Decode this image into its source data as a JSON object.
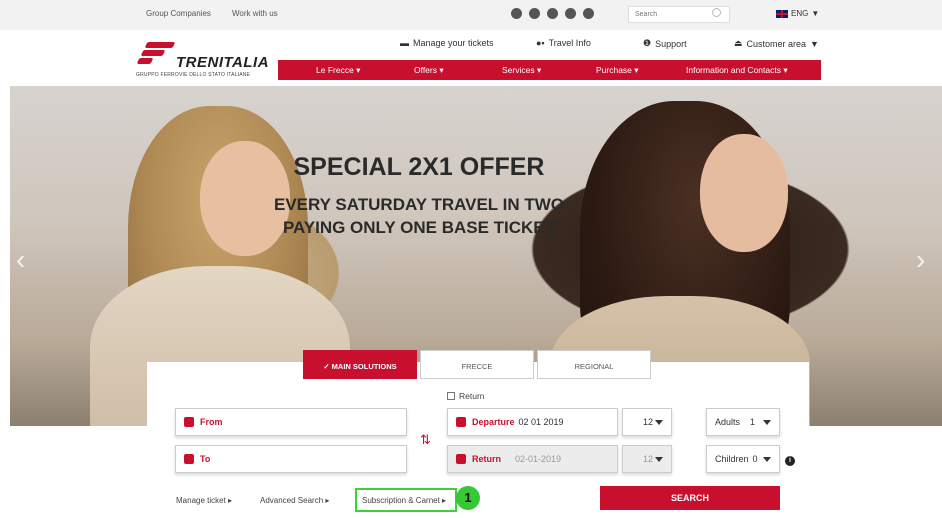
{
  "topbar": {
    "group_companies": "Group Companies",
    "work_with_us": "Work with us",
    "search_placeholder": "Search",
    "language": "ENG"
  },
  "header": {
    "logo_text": "TRENITALIA",
    "logo_subtitle": "GRUPPO FERROVIE DELLO STATO ITALIANE",
    "manage_tickets": "Manage your tickets",
    "travel_info": "Travel Info",
    "support": "Support",
    "customer_area": "Customer area"
  },
  "nav": {
    "items": [
      {
        "label": "Le Frecce"
      },
      {
        "label": "Offers"
      },
      {
        "label": "Services"
      },
      {
        "label": "Purchase"
      },
      {
        "label": "Information and Contacts"
      }
    ]
  },
  "hero": {
    "title": "SPECIAL 2X1 OFFER",
    "line1": "EVERY SATURDAY TRAVEL IN TWO",
    "line2": "PAYING ONLY ONE BASE TICKET"
  },
  "booking": {
    "tabs": [
      {
        "label": "✓ MAIN SOLUTIONS",
        "active": true
      },
      {
        "label": "FRECCE",
        "active": false
      },
      {
        "label": "REGIONAL",
        "active": false
      }
    ],
    "return_label": "Return",
    "from_label": "From",
    "to_label": "To",
    "departure_label": "Departure",
    "departure_date": "02 01 2019",
    "departure_hour": "12",
    "return_field_label": "Return",
    "return_date": "02-01-2019",
    "return_hour": "12",
    "adults_label": "Adults",
    "adults_value": "1",
    "children_label": "Children",
    "children_value": "0",
    "manage_ticket": "Manage ticket ▸",
    "advanced_search": "Advanced Search ▸",
    "subscription": "Subscription & Carnet ▸",
    "step_badge": "1",
    "search_button": "SEARCH"
  },
  "colors": {
    "brand_red": "#c8102e",
    "highlight_green": "#35c935"
  }
}
